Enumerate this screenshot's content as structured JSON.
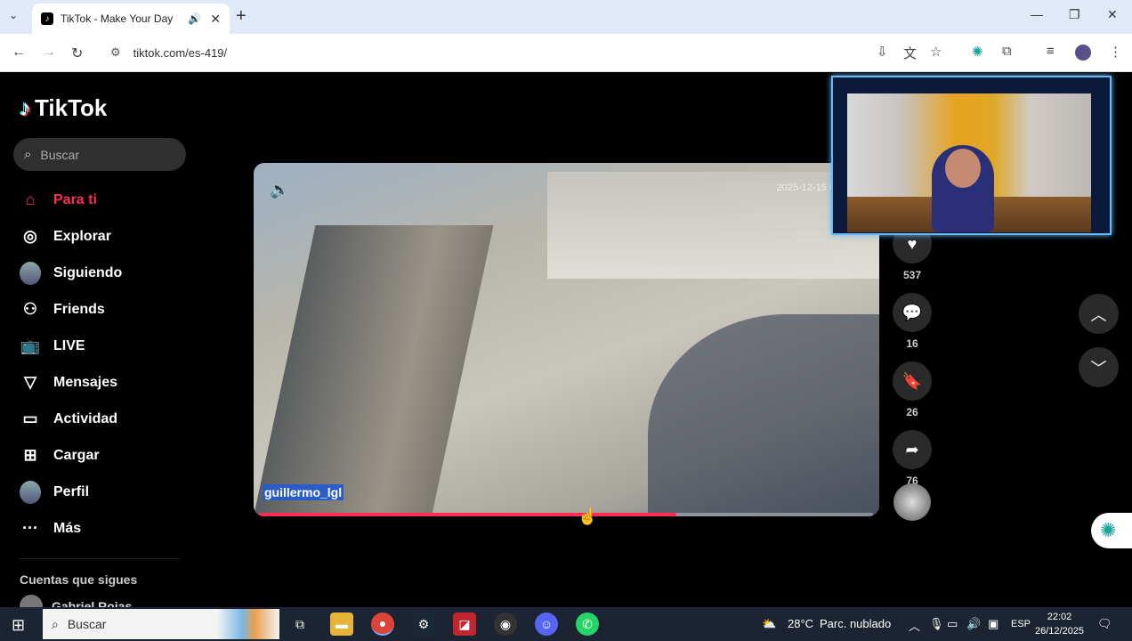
{
  "browser": {
    "tab_title": "TikTok - Make Your Day",
    "tab_favicon": "tiktok-icon",
    "new_tab": "+",
    "url": "tiktok.com/es-419/",
    "window_minimize": "—",
    "window_restore": "❐",
    "window_close": "✕"
  },
  "tiktok": {
    "logo": "TikTok",
    "search_placeholder": "Buscar",
    "menu": [
      {
        "label": "Para ti",
        "icon": "home-icon",
        "active": true
      },
      {
        "label": "Explorar",
        "icon": "compass-icon"
      },
      {
        "label": "Siguiendo",
        "icon": "avatar-icon"
      },
      {
        "label": "Friends",
        "icon": "friends-icon"
      },
      {
        "label": "LIVE",
        "icon": "live-icon"
      },
      {
        "label": "Mensajes",
        "icon": "send-icon"
      },
      {
        "label": "Actividad",
        "icon": "activity-icon"
      },
      {
        "label": "Cargar",
        "icon": "upload-icon"
      },
      {
        "label": "Perfil",
        "icon": "avatar-icon"
      },
      {
        "label": "Más",
        "icon": "more-icon"
      }
    ],
    "following_header": "Cuentas que sigues",
    "following_first": "Gabriel Rojas"
  },
  "video": {
    "username": "guillermo_lgl",
    "timestamp_overlay": "2025-12-15 6",
    "progress": 0.68,
    "likes": "537",
    "comments": "16",
    "saves": "26",
    "shares": "76"
  },
  "taskbar": {
    "search_label": "Buscar",
    "weather": "28°C",
    "weather_desc": "Parc. nublado",
    "lang": "ESP",
    "time": "22:02",
    "date": "26/12/2025"
  },
  "colors": {
    "accent": "#fe2c55",
    "webcam_border": "#67b9f5",
    "taskbar": "#1c2433"
  }
}
